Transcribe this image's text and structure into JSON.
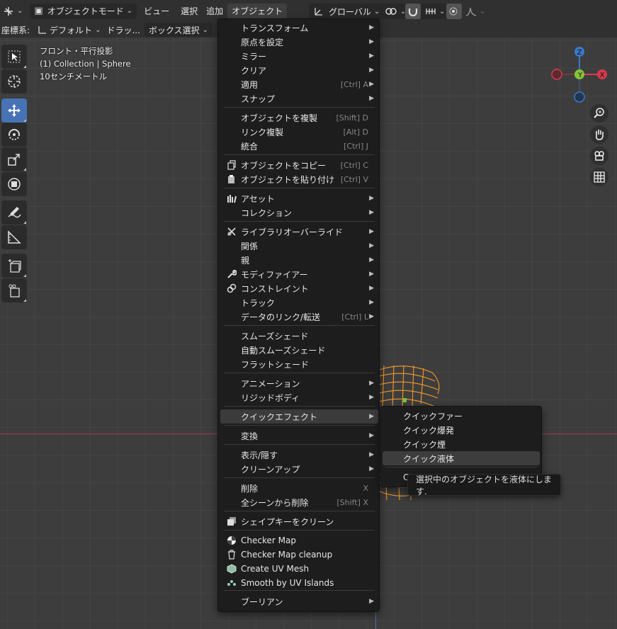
{
  "header": {
    "editor_icon": "editor-type-icon",
    "mode_label": "オブジェクトモード",
    "menus": [
      "ビュー",
      "選択",
      "追加",
      "オブジェクト"
    ],
    "transform_orientation": "グローバル",
    "coord_label": "座標系:",
    "coord_value": "デフォルト",
    "drag_label": "ドラッ...",
    "drag_value": "ボックス選択"
  },
  "viewport": {
    "view_name": "フロント・平行投影",
    "collection_info": "(1) Collection | Sphere",
    "scale": "10センチメートル",
    "gizmo": {
      "x": "X",
      "y": "Y",
      "z": "Z",
      "x_color": "#d9394e",
      "y_color": "#86c43a",
      "z_color": "#3b78c9"
    }
  },
  "menu": {
    "items": [
      {
        "label": "トランスフォーム",
        "submenu": true
      },
      {
        "label": "原点を設定",
        "submenu": true
      },
      {
        "label": "ミラー",
        "submenu": true
      },
      {
        "label": "クリア",
        "submenu": true
      },
      {
        "label": "適用",
        "shortcut": "[Ctrl] A",
        "submenu": true
      },
      {
        "label": "スナップ",
        "submenu": true
      },
      {
        "label": "オブジェクトを複製",
        "shortcut": "[Shift] D"
      },
      {
        "label": "リンク複製",
        "shortcut": "[Alt] D"
      },
      {
        "label": "統合",
        "shortcut": "[Ctrl] J"
      },
      {
        "label": "オブジェクトをコピー",
        "shortcut": "[Ctrl] C",
        "icon": "copy-icon"
      },
      {
        "label": "オブジェクトを貼り付け",
        "shortcut": "[Ctrl] V",
        "icon": "paste-icon"
      },
      {
        "label": "アセット",
        "submenu": true,
        "icon": "asset-icon"
      },
      {
        "label": "コレクション",
        "submenu": true
      },
      {
        "label": "ライブラリオーバーライド",
        "submenu": true,
        "icon": "library-override-icon"
      },
      {
        "label": "関係",
        "submenu": true
      },
      {
        "label": "親",
        "submenu": true
      },
      {
        "label": "モディファイアー",
        "submenu": true,
        "icon": "wrench-icon"
      },
      {
        "label": "コンストレイント",
        "submenu": true,
        "icon": "constraint-icon"
      },
      {
        "label": "トラック",
        "submenu": true
      },
      {
        "label": "データのリンク/転送",
        "shortcut": "[Ctrl] L",
        "submenu": true
      },
      {
        "label": "スムーズシェード"
      },
      {
        "label": "自動スムーズシェード"
      },
      {
        "label": "フラットシェード"
      },
      {
        "label": "アニメーション",
        "submenu": true
      },
      {
        "label": "リジッドボディ",
        "submenu": true
      },
      {
        "label": "クイックエフェクト",
        "submenu": true
      },
      {
        "label": "変換",
        "submenu": true
      },
      {
        "label": "表示/隠す",
        "submenu": true
      },
      {
        "label": "クリーンアップ",
        "submenu": true
      },
      {
        "label": "削除",
        "shortcut": "X"
      },
      {
        "label": "全シーンから削除",
        "shortcut": "[Shift] X"
      },
      {
        "label": "シェイプキーをクリーン",
        "icon": "shapekey-icon"
      },
      {
        "label": "Checker Map",
        "icon": "checker-icon"
      },
      {
        "label": "Checker Map cleanup",
        "icon": "trash-icon"
      },
      {
        "label": "Create UV Mesh",
        "icon": "uv-mesh-icon"
      },
      {
        "label": "Smooth by UV Islands",
        "icon": "uv-islands-icon"
      },
      {
        "label": "ブーリアン",
        "submenu": true
      }
    ]
  },
  "submenu": {
    "items": [
      "クイックファー",
      "クイック爆発",
      "クイック煙",
      "クイック液体"
    ],
    "partial_item": "C"
  },
  "tooltip": {
    "text": "選択中のオブジェクトを液体にします."
  }
}
